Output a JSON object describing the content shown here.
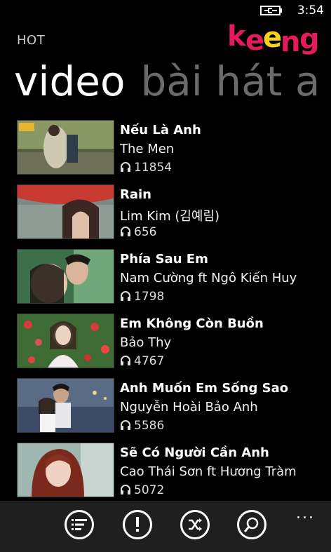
{
  "status": {
    "time": "3:54"
  },
  "brand": {
    "logo_text": "keeng"
  },
  "page": {
    "section": "HOT"
  },
  "pivot": {
    "active": "video",
    "next": "bài hát a"
  },
  "videos": [
    {
      "title": "Nếu Là Anh",
      "artist": "The Men",
      "plays": "11854"
    },
    {
      "title": "Rain",
      "artist": "Lim Kim (김예림)",
      "plays": "656"
    },
    {
      "title": "Phía Sau Em",
      "artist": "Nam Cường ft Ngô Kiến Huy",
      "plays": "1798"
    },
    {
      "title": "Em Không Còn Buồn",
      "artist": "Bảo Thy",
      "plays": "4767"
    },
    {
      "title": "Anh Muốn Em Sống Sao",
      "artist": "Nguyễn Hoài Bảo Anh",
      "plays": "5586"
    },
    {
      "title": "Sẽ Có Người Cần Anh",
      "artist": "Cao Thái Sơn ft Hương Tràm",
      "plays": "5072"
    }
  ],
  "appbar": {
    "buttons": [
      "list-icon",
      "alert-icon",
      "shuffle-icon",
      "search-icon"
    ],
    "more": "..."
  },
  "colors": {
    "background": "#000000",
    "appbar": "#1f1f1f",
    "inactive_pivot": "#6b6b6b",
    "logo_pink": "#e5195f",
    "logo_yellow": "#f6d21b"
  }
}
